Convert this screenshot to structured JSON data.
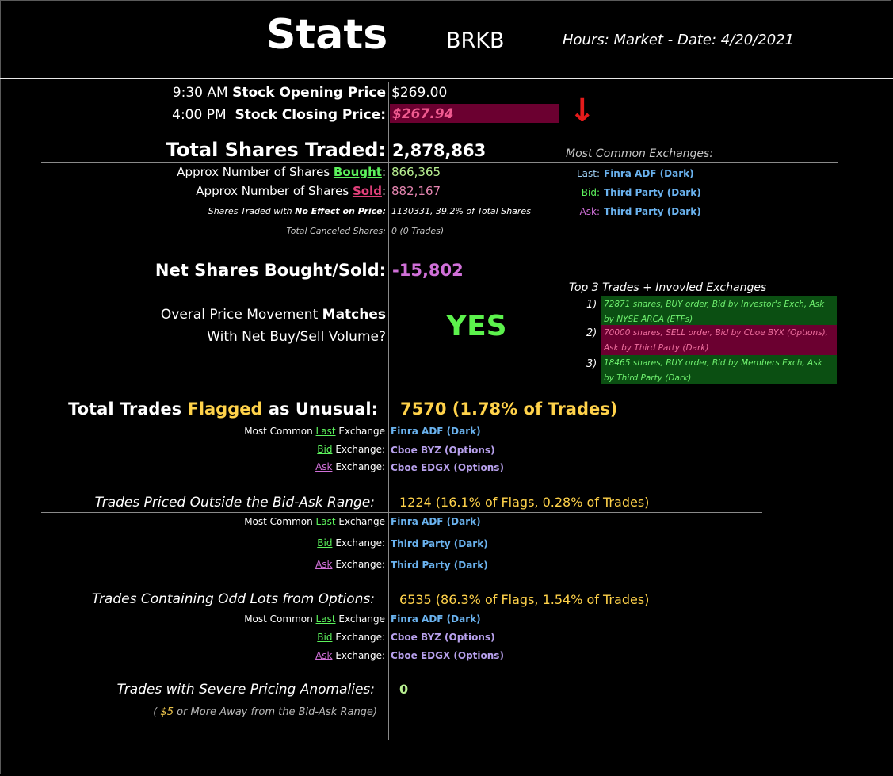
{
  "header": {
    "title": "Stats",
    "ticker": "BRKB",
    "session": "Hours: Market - Date: 4/20/2021"
  },
  "prices": {
    "open_time": "9:30 AM",
    "open_label": "Stock Opening Price",
    "open_value": "$269.00",
    "close_time": "4:00 PM",
    "close_label": "Stock Closing Price:",
    "close_value": "$267.94",
    "direction_arrow": "↓",
    "arrow_color": "#e31b1b",
    "close_bg": "#6b0030"
  },
  "volume": {
    "total_label": "Total Shares Traded:",
    "total_value": "2,878,863",
    "bought_prefix": "Approx Number of Shares",
    "bought_word": "Bought",
    "bought_value": "866,365",
    "sold_prefix": "Approx Number of Shares",
    "sold_word": "Sold",
    "sold_value": "882,167",
    "no_effect_prefix": "Shares Traded with",
    "no_effect_bold": "No Effect on Price:",
    "no_effect_value": "1130331, 39.2% of Total Shares",
    "canceled_label": "Total Canceled Shares:",
    "canceled_value": "0 (0 Trades)",
    "net_label": "Net Shares Bought/Sold:",
    "net_value": "-15,802"
  },
  "common_exchanges": {
    "title": "Most Common Exchanges:",
    "rows": [
      {
        "label": "Last:",
        "value": "Finra ADF (Dark)"
      },
      {
        "label": "Bid:",
        "value": "Third Party (Dark)"
      },
      {
        "label": "Ask:",
        "value": "Third Party (Dark)"
      }
    ]
  },
  "movement": {
    "line1_prefix": "Overal Price Movement",
    "line1_bold": "Matches",
    "line2": "With Net Buy/Sell Volume?",
    "answer": "YES"
  },
  "top_trades": {
    "title": "Top 3 Trades + Invovled Exchanges",
    "items": [
      {
        "num": "1)",
        "text": "72871 shares, BUY order, Bid by Investor's Exch, Ask by NYSE ARCA (ETFs)",
        "bg": "#0b4f12",
        "color": "#6ff06f"
      },
      {
        "num": "2)",
        "text": "70000 shares, SELL order, Bid by Cboe BYX (Options), Ask by Third Party (Dark)",
        "bg": "#6b0030",
        "color": "#f070a0"
      },
      {
        "num": "3)",
        "text": "18465 shares, BUY order, Bid by Members Exch, Ask by Third Party (Dark)",
        "bg": "#0b4f12",
        "color": "#6ff06f"
      }
    ]
  },
  "flagged": {
    "label_pre": "Total Trades",
    "label_flag": "Flagged",
    "label_post": "as Unusual:",
    "value": "7570 (1.78% of Trades)",
    "rows": [
      {
        "pre": "Most Common",
        "word": "Last",
        "post": "Exchange",
        "value": "Finra ADF (Dark)"
      },
      {
        "pre": "",
        "word": "Bid",
        "post": "Exchange:",
        "value": "Cboe BYZ (Options)"
      },
      {
        "pre": "",
        "word": "Ask",
        "post": "Exchange:",
        "value": "Cboe EDGX (Options)"
      }
    ]
  },
  "outside": {
    "label": "Trades Priced Outside the Bid-Ask Range:",
    "value": "1224 (16.1% of Flags, 0.28% of Trades)",
    "rows": [
      {
        "pre": "Most Common",
        "word": "Last",
        "post": "Exchange",
        "value": "Finra ADF (Dark)"
      },
      {
        "pre": "",
        "word": "Bid",
        "post": "Exchange:",
        "value": "Third Party (Dark)"
      },
      {
        "pre": "",
        "word": "Ask",
        "post": "Exchange:",
        "value": "Third Party (Dark)"
      }
    ]
  },
  "odd_lots": {
    "label": "Trades Containing Odd Lots from Options:",
    "value": "6535 (86.3% of Flags, 1.54% of Trades)",
    "rows": [
      {
        "pre": "Most Common",
        "word": "Last",
        "post": "Exchange",
        "value": "Finra ADF (Dark)"
      },
      {
        "pre": "",
        "word": "Bid",
        "post": "Exchange:",
        "value": "Cboe BYZ (Options)"
      },
      {
        "pre": "",
        "word": "Ask",
        "post": "Exchange:",
        "value": "Cboe EDGX (Options)"
      }
    ]
  },
  "severe": {
    "label": "Trades with Severe Pricing Anomalies:",
    "value": "0",
    "note_open": "(",
    "note_amount": "$5",
    "note_rest": "or More Away from the Bid-Ask Range)"
  }
}
